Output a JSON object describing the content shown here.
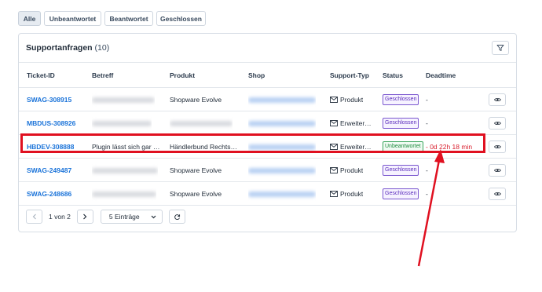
{
  "filters": {
    "tabs": [
      {
        "label": "Alle",
        "active": true
      },
      {
        "label": "Unbeantwortet",
        "active": false
      },
      {
        "label": "Beantwortet",
        "active": false
      },
      {
        "label": "Geschlossen",
        "active": false
      }
    ]
  },
  "card": {
    "title": "Supportanfragen",
    "count": "(10)",
    "filter_icon": "filter-icon"
  },
  "table": {
    "columns": [
      "Ticket-ID",
      "Betreff",
      "Produkt",
      "Shop",
      "Support-Typ",
      "Status",
      "Deadtime"
    ],
    "rows": [
      {
        "ticket_id": "SWAG-308915",
        "subject": "",
        "subject_blurred": true,
        "product": "Shopware Evolve",
        "product_blurred": false,
        "support_type": "Produkt",
        "status": "Geschlossen",
        "deadtime": "-"
      },
      {
        "ticket_id": "MBDUS-308926",
        "subject": "",
        "subject_blurred": true,
        "product": "",
        "product_blurred": true,
        "support_type": "Erweiter…",
        "status": "Geschlossen",
        "deadtime": "-"
      },
      {
        "ticket_id": "HBDEV-308888",
        "subject": "Plugin lässt sich gar …",
        "subject_blurred": false,
        "product": "Händlerbund Rechts…",
        "product_blurred": false,
        "support_type": "Erweiter…",
        "status": "Unbeantwortet",
        "deadtime": "- 0d 22h 18 min"
      },
      {
        "ticket_id": "SWAG-249487",
        "subject": "",
        "subject_blurred": true,
        "product": "Shopware Evolve",
        "product_blurred": false,
        "support_type": "Produkt",
        "status": "Geschlossen",
        "deadtime": "-"
      },
      {
        "ticket_id": "SWAG-248686",
        "subject": "",
        "subject_blurred": true,
        "product": "Shopware Evolve",
        "product_blurred": false,
        "support_type": "Produkt",
        "status": "Geschlossen",
        "deadtime": "-"
      }
    ]
  },
  "pagination": {
    "prev_icon": "chevron-left-icon",
    "page_label": "1 von 2",
    "next_icon": "chevron-right-icon",
    "page_size_label": "5 Einträge",
    "refresh_icon": "refresh-icon"
  },
  "colors": {
    "link": "#1a73d9",
    "status_closed": "#5b2dbd",
    "status_open": "#1b8a3c",
    "alert": "#d81c2b",
    "annotation": "#e01020"
  }
}
